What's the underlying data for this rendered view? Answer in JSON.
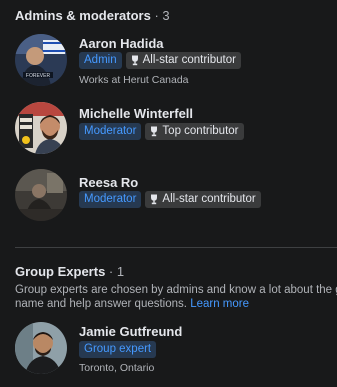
{
  "admins": {
    "title": "Admins & moderators",
    "count": "· 3",
    "members": [
      {
        "name": "Aaron Hadida",
        "role": "Admin",
        "contribution": "All-star contributor",
        "subtext": "Works at Herut Canada",
        "avatar_label": "FOREVER"
      },
      {
        "name": "Michelle Winterfell",
        "role": "Moderator",
        "contribution": "Top contributor"
      },
      {
        "name": "Reesa Ro",
        "role": "Moderator",
        "contribution": "All-star contributor"
      }
    ]
  },
  "experts": {
    "title": "Group Experts",
    "count": "· 1",
    "description_line1": "Group experts are chosen by admins and know a lot about the group.",
    "description_line2": "name and help answer questions.",
    "learn_more": "Learn more",
    "members": [
      {
        "name": "Jamie Gutfreund",
        "role": "Group expert",
        "subtext": "Toronto, Ontario"
      }
    ]
  },
  "icons": {
    "contribution_badge": "trophy-icon"
  },
  "colors": {
    "background": "#18191a",
    "primary_text": "#e4e6eb",
    "secondary_text": "#b0b3b8",
    "role_badge_bg": "#263951",
    "role_badge_text": "#4599ff",
    "contrib_badge_bg": "#3a3b3c",
    "link": "#4599ff"
  }
}
